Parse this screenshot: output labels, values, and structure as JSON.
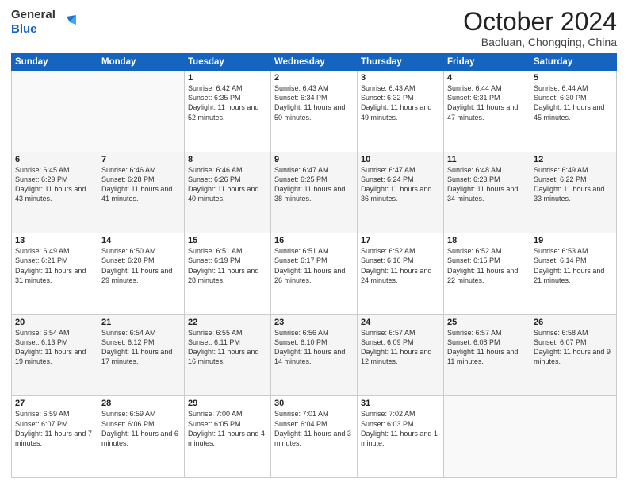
{
  "header": {
    "logo_general": "General",
    "logo_blue": "Blue",
    "month": "October 2024",
    "location": "Baoluan, Chongqing, China"
  },
  "days_of_week": [
    "Sunday",
    "Monday",
    "Tuesday",
    "Wednesday",
    "Thursday",
    "Friday",
    "Saturday"
  ],
  "weeks": [
    [
      {
        "day": "",
        "info": ""
      },
      {
        "day": "",
        "info": ""
      },
      {
        "day": "1",
        "info": "Sunrise: 6:42 AM\nSunset: 6:35 PM\nDaylight: 11 hours and 52 minutes."
      },
      {
        "day": "2",
        "info": "Sunrise: 6:43 AM\nSunset: 6:34 PM\nDaylight: 11 hours and 50 minutes."
      },
      {
        "day": "3",
        "info": "Sunrise: 6:43 AM\nSunset: 6:32 PM\nDaylight: 11 hours and 49 minutes."
      },
      {
        "day": "4",
        "info": "Sunrise: 6:44 AM\nSunset: 6:31 PM\nDaylight: 11 hours and 47 minutes."
      },
      {
        "day": "5",
        "info": "Sunrise: 6:44 AM\nSunset: 6:30 PM\nDaylight: 11 hours and 45 minutes."
      }
    ],
    [
      {
        "day": "6",
        "info": "Sunrise: 6:45 AM\nSunset: 6:29 PM\nDaylight: 11 hours and 43 minutes."
      },
      {
        "day": "7",
        "info": "Sunrise: 6:46 AM\nSunset: 6:28 PM\nDaylight: 11 hours and 41 minutes."
      },
      {
        "day": "8",
        "info": "Sunrise: 6:46 AM\nSunset: 6:26 PM\nDaylight: 11 hours and 40 minutes."
      },
      {
        "day": "9",
        "info": "Sunrise: 6:47 AM\nSunset: 6:25 PM\nDaylight: 11 hours and 38 minutes."
      },
      {
        "day": "10",
        "info": "Sunrise: 6:47 AM\nSunset: 6:24 PM\nDaylight: 11 hours and 36 minutes."
      },
      {
        "day": "11",
        "info": "Sunrise: 6:48 AM\nSunset: 6:23 PM\nDaylight: 11 hours and 34 minutes."
      },
      {
        "day": "12",
        "info": "Sunrise: 6:49 AM\nSunset: 6:22 PM\nDaylight: 11 hours and 33 minutes."
      }
    ],
    [
      {
        "day": "13",
        "info": "Sunrise: 6:49 AM\nSunset: 6:21 PM\nDaylight: 11 hours and 31 minutes."
      },
      {
        "day": "14",
        "info": "Sunrise: 6:50 AM\nSunset: 6:20 PM\nDaylight: 11 hours and 29 minutes."
      },
      {
        "day": "15",
        "info": "Sunrise: 6:51 AM\nSunset: 6:19 PM\nDaylight: 11 hours and 28 minutes."
      },
      {
        "day": "16",
        "info": "Sunrise: 6:51 AM\nSunset: 6:17 PM\nDaylight: 11 hours and 26 minutes."
      },
      {
        "day": "17",
        "info": "Sunrise: 6:52 AM\nSunset: 6:16 PM\nDaylight: 11 hours and 24 minutes."
      },
      {
        "day": "18",
        "info": "Sunrise: 6:52 AM\nSunset: 6:15 PM\nDaylight: 11 hours and 22 minutes."
      },
      {
        "day": "19",
        "info": "Sunrise: 6:53 AM\nSunset: 6:14 PM\nDaylight: 11 hours and 21 minutes."
      }
    ],
    [
      {
        "day": "20",
        "info": "Sunrise: 6:54 AM\nSunset: 6:13 PM\nDaylight: 11 hours and 19 minutes."
      },
      {
        "day": "21",
        "info": "Sunrise: 6:54 AM\nSunset: 6:12 PM\nDaylight: 11 hours and 17 minutes."
      },
      {
        "day": "22",
        "info": "Sunrise: 6:55 AM\nSunset: 6:11 PM\nDaylight: 11 hours and 16 minutes."
      },
      {
        "day": "23",
        "info": "Sunrise: 6:56 AM\nSunset: 6:10 PM\nDaylight: 11 hours and 14 minutes."
      },
      {
        "day": "24",
        "info": "Sunrise: 6:57 AM\nSunset: 6:09 PM\nDaylight: 11 hours and 12 minutes."
      },
      {
        "day": "25",
        "info": "Sunrise: 6:57 AM\nSunset: 6:08 PM\nDaylight: 11 hours and 11 minutes."
      },
      {
        "day": "26",
        "info": "Sunrise: 6:58 AM\nSunset: 6:07 PM\nDaylight: 11 hours and 9 minutes."
      }
    ],
    [
      {
        "day": "27",
        "info": "Sunrise: 6:59 AM\nSunset: 6:07 PM\nDaylight: 11 hours and 7 minutes."
      },
      {
        "day": "28",
        "info": "Sunrise: 6:59 AM\nSunset: 6:06 PM\nDaylight: 11 hours and 6 minutes."
      },
      {
        "day": "29",
        "info": "Sunrise: 7:00 AM\nSunset: 6:05 PM\nDaylight: 11 hours and 4 minutes."
      },
      {
        "day": "30",
        "info": "Sunrise: 7:01 AM\nSunset: 6:04 PM\nDaylight: 11 hours and 3 minutes."
      },
      {
        "day": "31",
        "info": "Sunrise: 7:02 AM\nSunset: 6:03 PM\nDaylight: 11 hours and 1 minute."
      },
      {
        "day": "",
        "info": ""
      },
      {
        "day": "",
        "info": ""
      }
    ]
  ]
}
